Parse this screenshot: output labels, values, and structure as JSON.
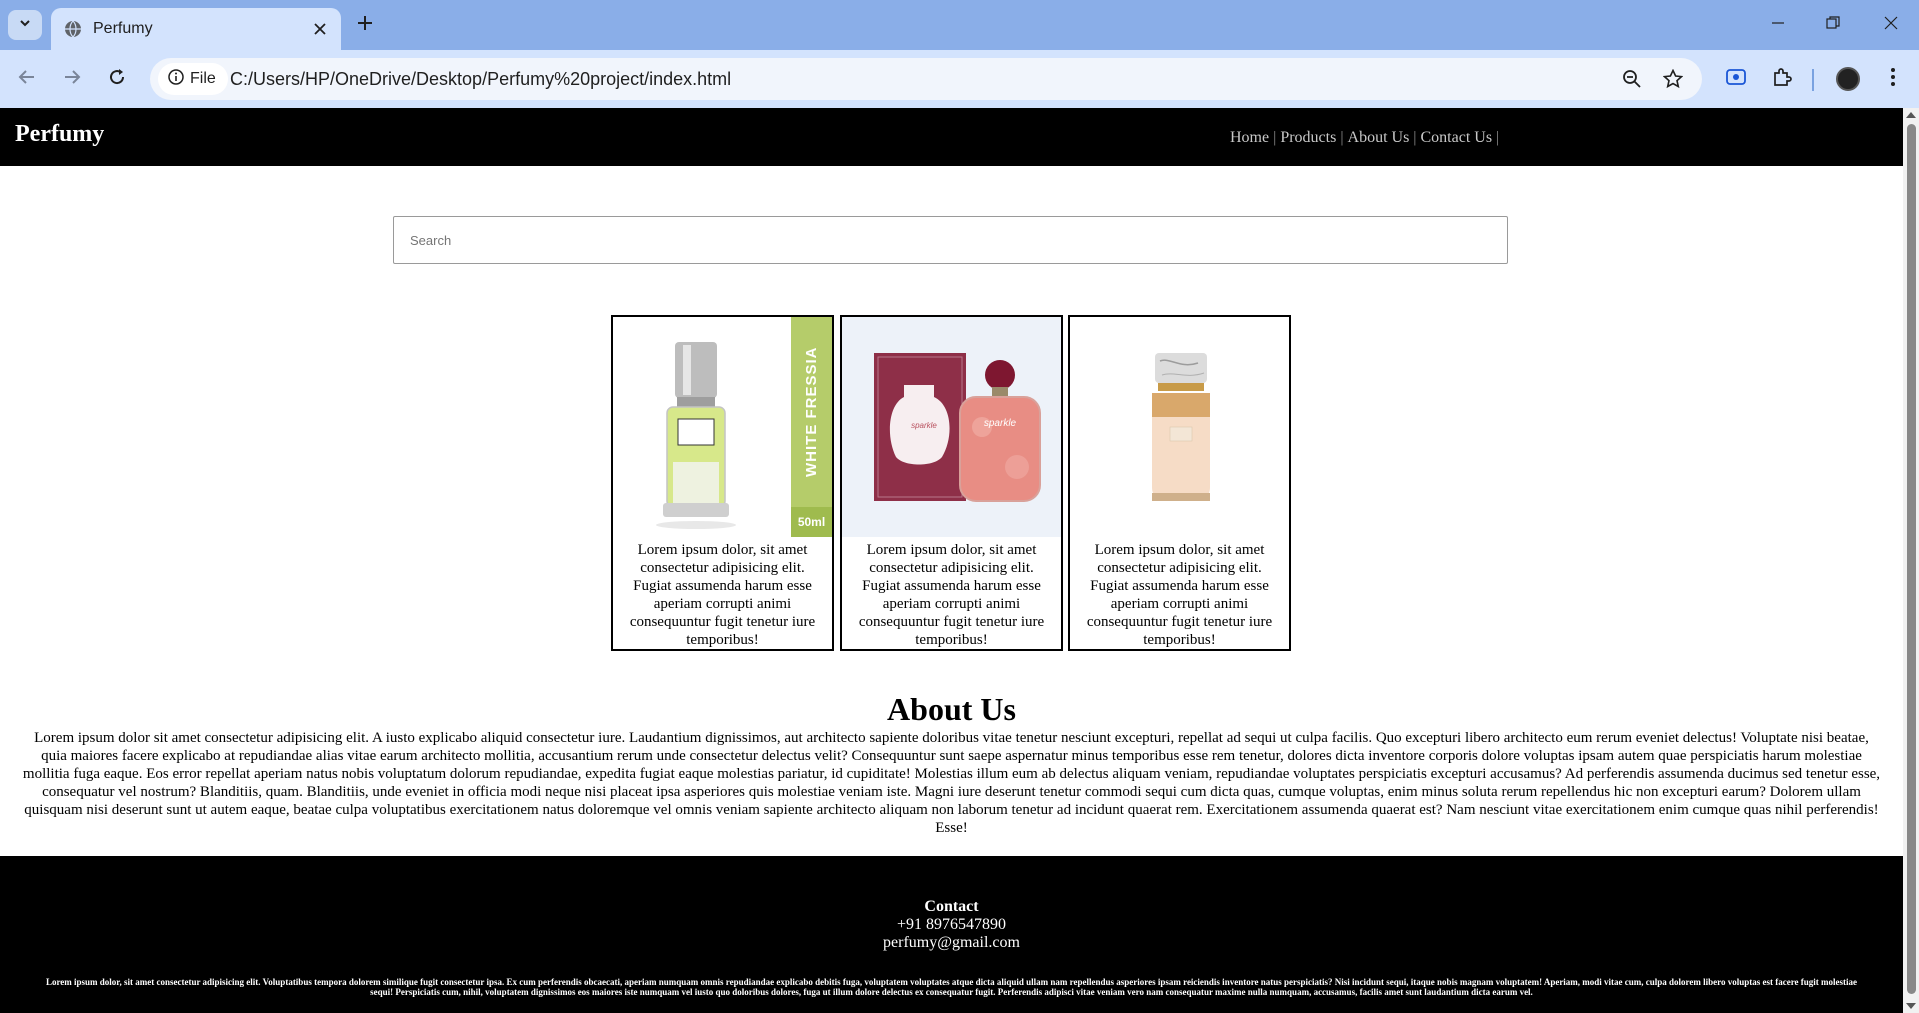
{
  "browser": {
    "tab_title": "Perfumy",
    "site_chip_label": "File",
    "url": "C:/Users/HP/OneDrive/Desktop/Perfumy%20project/index.html"
  },
  "header": {
    "logo": "Perfumy",
    "nav": [
      {
        "label": "Home"
      },
      {
        "label": "Products"
      },
      {
        "label": "About Us"
      },
      {
        "label": "Contact Us"
      }
    ],
    "separator": "|"
  },
  "search": {
    "placeholder": "Search",
    "value": ""
  },
  "products": [
    {
      "image_text": "WHITE FRESSIA",
      "image_volume": "50ml",
      "description": "Lorem ipsum dolor, sit amet consectetur adipisicing elit. Fugiat assumenda harum esse aperiam corrupti animi consequuntur fugit tenetur iure temporibus!"
    },
    {
      "image_text": "sparkle",
      "description": "Lorem ipsum dolor, sit amet consectetur adipisicing elit. Fugiat assumenda harum esse aperiam corrupti animi consequuntur fugit tenetur iure temporibus!"
    },
    {
      "description": "Lorem ipsum dolor, sit amet consectetur adipisicing elit. Fugiat assumenda harum esse aperiam corrupti animi consequuntur fugit tenetur iure temporibus!"
    }
  ],
  "about": {
    "title": "About Us",
    "text": "Lorem ipsum dolor sit amet consectetur adipisicing elit. A iusto explicabo aliquid consectetur iure. Laudantium dignissimos, aut architecto sapiente doloribus vitae tenetur nesciunt excepturi, repellat ad sequi ut culpa facilis. Quo excepturi libero architecto eum rerum eveniet delectus! Voluptate nisi beatae, quia maiores facere explicabo at repudiandae alias vitae earum architecto mollitia, accusantium rerum unde consectetur delectus velit? Consequuntur sunt saepe aspernatur minus temporibus esse rem tenetur, dolores dicta inventore corporis dolore voluptas ipsam autem quae perspiciatis harum molestiae mollitia fuga eaque. Eos error repellat aperiam natus nobis voluptatum dolorum repudiandae, expedita fugiat eaque molestias pariatur, id cupiditate! Molestias illum eum ab delectus aliquam veniam, repudiandae voluptates perspiciatis excepturi accusamus? Ad perferendis assumenda ducimus sed tenetur esse, consequatur vel nostrum? Blanditiis, quam. Blanditiis, unde eveniet in officia modi neque nisi placeat ipsa asperiores quis molestiae veniam iste. Magni iure deserunt tenetur commodi sequi cum dicta quas, cumque voluptas, enim minus soluta rerum repellendus hic non excepturi earum? Dolorem ullam quisquam nisi deserunt sunt ut autem eaque, beatae culpa voluptatibus exercitationem natus doloremque vel omnis veniam sapiente architecto aliquam non laborum tenetur ad incidunt quaerat rem. Exercitationem assumenda quaerat est? Nam nesciunt vitae exercitationem enim cumque quas nihil perferendis! Esse!"
  },
  "footer": {
    "title": "Contact",
    "phone": "+91 8976547890",
    "email": "perfumy@gmail.com",
    "fine_print": "Lorem ipsum dolor, sit amet consectetur adipisicing elit. Voluptatibus tempora dolorem similique fugit consectetur ipsa. Ex cum perferendis obcaecati, aperiam numquam omnis repudiandae explicabo debitis fuga, voluptatem voluptates atque dicta aliquid ullam nam repellendus asperiores ipsam reiciendis inventore natus perspiciatis? Nisi incidunt sequi, itaque nobis magnam voluptatem! Aperiam, modi vitae cum, culpa dolorem libero voluptas est facere fugit molestiae sequi! Perspiciatis cum, nihil, voluptatem dignissimos eos maiores iste numquam vel iusto quo doloribus dolores, fuga ut illum dolore delectus ex consequatur fugit. Perferendis adipisci vitae veniam vero nam consequatur maxime nulla numquam, accusamus, facilis amet sunt laudantium dicta earum vel."
  },
  "colors": {
    "tabbar": "#8aaee8",
    "toolbar": "#d3e3fd",
    "site_header": "#000000",
    "footer": "#000000",
    "fressia_green": "#b5cc6a",
    "sparkle_box": "#8e2f48"
  }
}
